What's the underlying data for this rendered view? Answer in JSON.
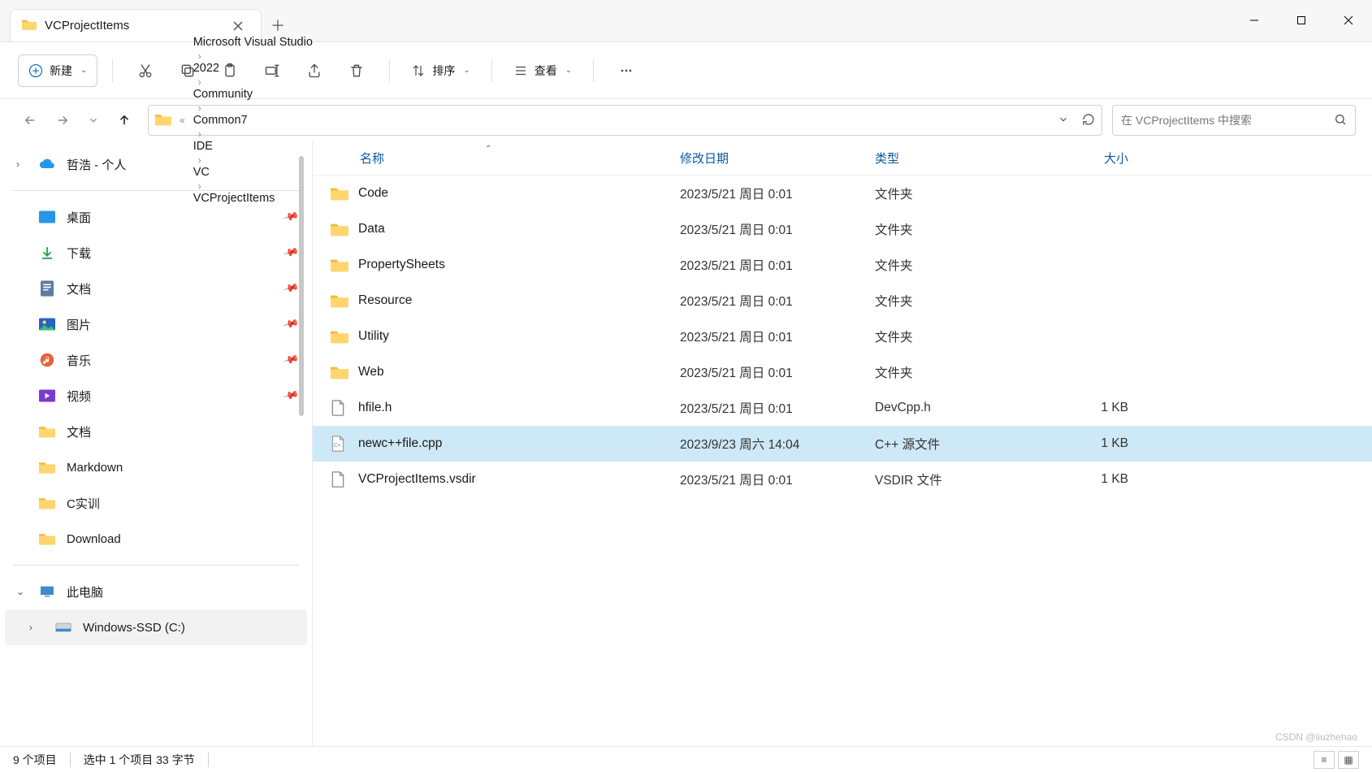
{
  "tab": {
    "title": "VCProjectItems"
  },
  "toolbar": {
    "new_label": "新建",
    "sort_label": "排序",
    "view_label": "查看",
    "icons": {
      "cut": "cut-icon",
      "copy": "copy-icon",
      "paste": "paste-icon",
      "rename": "rename-icon",
      "share": "share-icon",
      "delete": "delete-icon",
      "more": "more-icon"
    }
  },
  "breadcrumb": {
    "items": [
      "Microsoft Visual Studio",
      "2022",
      "Community",
      "Common7",
      "IDE",
      "VC",
      "VCProjectItems"
    ],
    "prefix": "«"
  },
  "search": {
    "placeholder": "在 VCProjectItems 中搜索"
  },
  "sidebar": {
    "top": {
      "label": "哲浩 - 个人"
    },
    "quick": [
      {
        "label": "桌面",
        "icon": "desktop"
      },
      {
        "label": "下载",
        "icon": "download"
      },
      {
        "label": "文档",
        "icon": "document"
      },
      {
        "label": "图片",
        "icon": "picture"
      },
      {
        "label": "音乐",
        "icon": "music"
      },
      {
        "label": "视频",
        "icon": "video"
      },
      {
        "label": "文档",
        "icon": "folder"
      },
      {
        "label": "Markdown",
        "icon": "folder"
      },
      {
        "label": "C实训",
        "icon": "folder"
      },
      {
        "label": "Download",
        "icon": "folder"
      }
    ],
    "pc": {
      "label": "此电脑"
    },
    "drive": {
      "label": "Windows-SSD (C:)"
    }
  },
  "columns": {
    "name": "名称",
    "date": "修改日期",
    "type": "类型",
    "size": "大小"
  },
  "files": [
    {
      "name": "Code",
      "date": "2023/5/21 周日 0:01",
      "type": "文件夹",
      "size": "",
      "kind": "folder",
      "selected": false
    },
    {
      "name": "Data",
      "date": "2023/5/21 周日 0:01",
      "type": "文件夹",
      "size": "",
      "kind": "folder",
      "selected": false
    },
    {
      "name": "PropertySheets",
      "date": "2023/5/21 周日 0:01",
      "type": "文件夹",
      "size": "",
      "kind": "folder",
      "selected": false
    },
    {
      "name": "Resource",
      "date": "2023/5/21 周日 0:01",
      "type": "文件夹",
      "size": "",
      "kind": "folder",
      "selected": false
    },
    {
      "name": "Utility",
      "date": "2023/5/21 周日 0:01",
      "type": "文件夹",
      "size": "",
      "kind": "folder",
      "selected": false
    },
    {
      "name": "Web",
      "date": "2023/5/21 周日 0:01",
      "type": "文件夹",
      "size": "",
      "kind": "folder",
      "selected": false
    },
    {
      "name": "hfile.h",
      "date": "2023/5/21 周日 0:01",
      "type": "DevCpp.h",
      "size": "1 KB",
      "kind": "file",
      "selected": false
    },
    {
      "name": "newc++file.cpp",
      "date": "2023/9/23 周六 14:04",
      "type": "C++ 源文件",
      "size": "1 KB",
      "kind": "cpp",
      "selected": true
    },
    {
      "name": "VCProjectItems.vsdir",
      "date": "2023/5/21 周日 0:01",
      "type": "VSDIR 文件",
      "size": "1 KB",
      "kind": "file",
      "selected": false
    }
  ],
  "status": {
    "items": "9 个项目",
    "selection": "选中 1 个项目  33 字节"
  },
  "watermark": "CSDN @liuzhehao"
}
